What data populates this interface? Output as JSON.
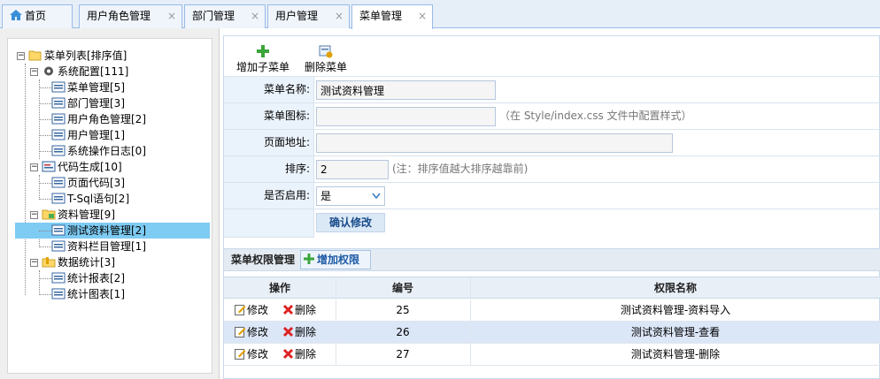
{
  "tabs": [
    {
      "label": "首页",
      "closable": false,
      "active": false
    },
    {
      "label": "用户角色管理",
      "closable": true,
      "active": false
    },
    {
      "label": "部门管理",
      "closable": true,
      "active": false
    },
    {
      "label": "用户管理",
      "closable": true,
      "active": false
    },
    {
      "label": "菜单管理",
      "closable": true,
      "active": true
    }
  ],
  "tab_close_glyph": "×",
  "tree": {
    "root": "菜单列表[排序值]",
    "groups": [
      {
        "label": "系统配置[111]",
        "icon": "gear-icon",
        "children": [
          "菜单管理[5]",
          "部门管理[3]",
          "用户角色管理[2]",
          "用户管理[1]",
          "系统操作日志[0]"
        ]
      },
      {
        "label": "代码生成[10]",
        "icon": "code-icon",
        "children": [
          "页面代码[3]",
          "T-Sql语句[2]"
        ]
      },
      {
        "label": "资料管理[9]",
        "icon": "folder-icon",
        "children": [
          "测试资料管理[2]",
          "资料栏目管理[1]"
        ]
      },
      {
        "label": "数据统计[3]",
        "icon": "chart-folder-icon",
        "children": [
          "统计报表[2]",
          "统计图表[1]"
        ]
      }
    ],
    "selected": "测试资料管理[2]",
    "expander_glyph": "−"
  },
  "toolbar": {
    "add_child_label": "增加子菜单",
    "delete_label": "删除菜单"
  },
  "form": {
    "name_label": "菜单名称:",
    "name_value": "测试资料管理",
    "icon_label": "菜单图标:",
    "icon_value": "",
    "icon_hint": "（在 Style/index.css 文件中配置样式）",
    "url_label": "页面地址:",
    "url_value": "",
    "sort_label": "排序:",
    "sort_value": "2",
    "sort_hint": "(注：排序值越大排序越靠前)",
    "enabled_label": "是否启用:",
    "enabled_value": "是",
    "confirm_label": "确认修改"
  },
  "permissions": {
    "title": "菜单权限管理",
    "add_label": "增加权限",
    "columns": [
      "操作",
      "编号",
      "权限名称"
    ],
    "edit_label": "修改",
    "delete_label": "删除",
    "rows": [
      {
        "id": "25",
        "name": "测试资料管理-资料导入"
      },
      {
        "id": "26",
        "name": "测试资料管理-查看"
      },
      {
        "id": "27",
        "name": "测试资料管理-删除"
      }
    ]
  },
  "colors": {
    "accent": "#99bbe8",
    "selected_node": "#7ecbf3",
    "label_bg": "#eaf2fb",
    "highlight_row": "#dbe6f7"
  }
}
